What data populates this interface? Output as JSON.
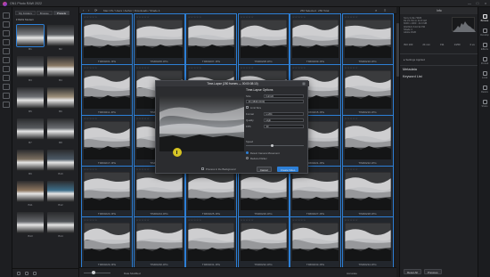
{
  "app": {
    "title": "ON1 Photo RAW 2022"
  },
  "window_controls": [
    "—",
    "□",
    "×"
  ],
  "browser": {
    "tabs": [
      "My Folders",
      "Browse",
      "Presets"
    ],
    "active_tab": "Presets",
    "folder_label": "▾ B&W Modern",
    "presets": [
      {
        "label": "B1"
      },
      {
        "label": "B2"
      },
      {
        "label": "B3"
      },
      {
        "label": "B4"
      },
      {
        "label": "B5"
      },
      {
        "label": "B6"
      },
      {
        "label": "B7"
      },
      {
        "label": "B8"
      },
      {
        "label": "B9"
      },
      {
        "label": "B10"
      },
      {
        "label": "B11"
      },
      {
        "label": "B12"
      },
      {
        "label": "B13"
      },
      {
        "label": "B14"
      }
    ]
  },
  "pathbar": {
    "path": "Mac OS / Users / Author / Downloads / Shade 4",
    "selection_count": "250 Selected · 250 Total"
  },
  "grid": {
    "stars": "☆☆☆☆☆",
    "files": [
      "TIM00201.JPG",
      "TIM00206.JPG",
      "TIM00207.JPG",
      "TIM00208.JPG",
      "TIM00209.JPG",
      "TIM00210.JPG",
      "TIM00211.JPG",
      "TIM00212.JPG",
      "TIM00213.JPG",
      "TIM00214.JPG",
      "TIM00215.JPG",
      "TIM00216.JPG",
      "TIM00217.JPG",
      "TIM00218.JPG",
      "TIM00219.JPG",
      "TIM00220.JPG",
      "TIM00221.JPG",
      "TIM00222.JPG",
      "TIM00223.JPG",
      "TIM00224.JPG",
      "TIM00225.JPG",
      "TIM00226.JPG",
      "TIM00227.JPG",
      "TIM00228.JPG",
      "TIM00229.JPG",
      "TIM00230.JPG",
      "TIM00231.JPG",
      "TIM00232.JPG",
      "TIM00233.JPG",
      "TIM00234.JPG"
    ]
  },
  "bottombar": {
    "sort": "Date Modified",
    "previews": "Accurate"
  },
  "info_panel": {
    "title": "Info",
    "lines": [
      "Sony ILCE-7RM3",
      "FE 24-70mm F2.8 GM",
      "6000 x 4000 · 24.6 MB",
      "9/3/2021 6:10:32 PM",
      "Shade 4",
      "Adobe RGB"
    ],
    "exif": [
      "ISO 100",
      "24 mm",
      "f/11",
      "1/250",
      "0 ev"
    ],
    "settings_label": "▸  Settings Applied",
    "metadata_title": "Metadata",
    "keyword_title": "Keyword List",
    "buttons": [
      "Reset All",
      "Previous"
    ]
  },
  "modes": [
    "Browse",
    "Develop",
    "Effects",
    "Portrait",
    "Local",
    "Resize",
    "Share"
  ],
  "dialog": {
    "title": "Time-Lapse (250 frames — 00:00:08:10)",
    "options_title": "Time-Lapse Options",
    "rows": [
      {
        "label": "Size",
        "value": "Full HD"
      },
      {
        "label": "Format",
        "value": "H.264"
      },
      {
        "label": "Quality",
        "value": "High"
      },
      {
        "label": "FPS",
        "value": "30"
      }
    ],
    "path_row": "4K (3840×2160)",
    "limit_label": "Limit Size",
    "speed_label": "Speed",
    "radio_1": "Detect Camera Movement",
    "radio_2": "Reduce Flicker",
    "background_label": "Process in the Background",
    "cancel": "Cancel",
    "create": "Create Video"
  },
  "colors": {
    "accent": "#2d7fd6",
    "cursor": "#f5e228",
    "background": "#1a1b1d"
  }
}
